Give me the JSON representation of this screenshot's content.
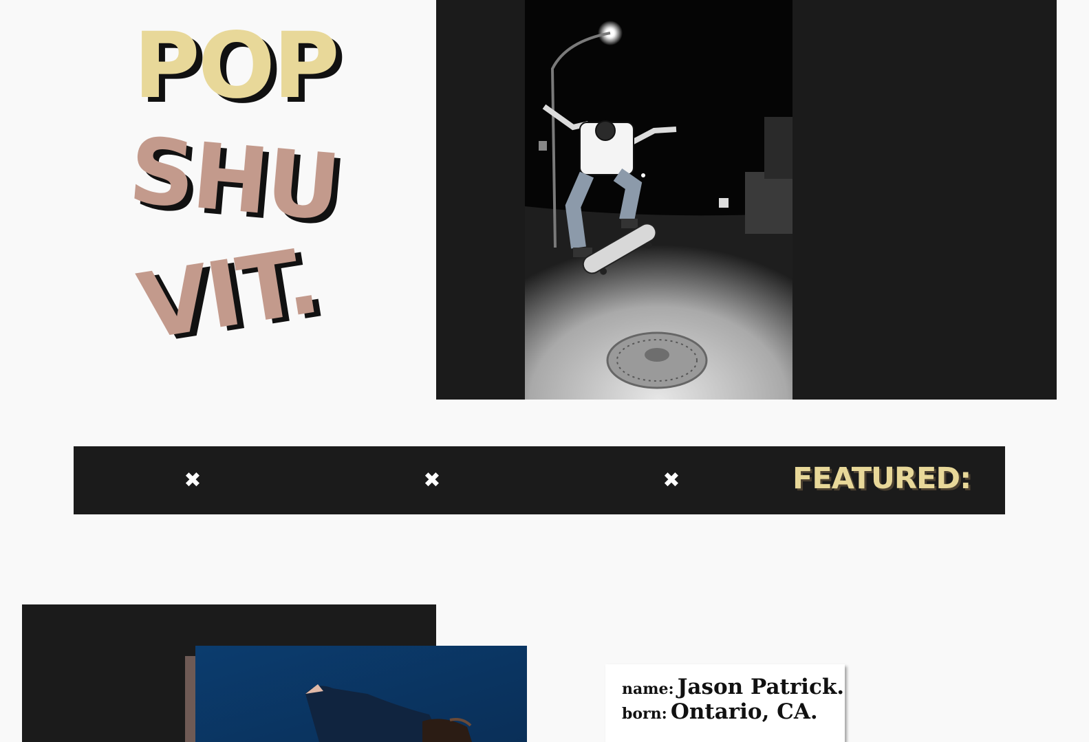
{
  "hero": {
    "title_words": [
      "POP",
      "SHU",
      "VIT."
    ],
    "photo_icon": "skateboarder-night-photo"
  },
  "ticker": {
    "separator_glyph": "✖",
    "featured_label": "FEATURED:"
  },
  "feature": {
    "photo_icon": "skater-blue-sky-photo",
    "info": {
      "name_key": "name:",
      "name_value": "Jason Patrick.",
      "born_key": "born:",
      "born_value": "Ontario, CA."
    }
  },
  "colors": {
    "gold": "#e8d899",
    "rose": "#c39a8c",
    "dark_panel": "#1b1b1b",
    "page_bg": "#f9f9f9"
  }
}
